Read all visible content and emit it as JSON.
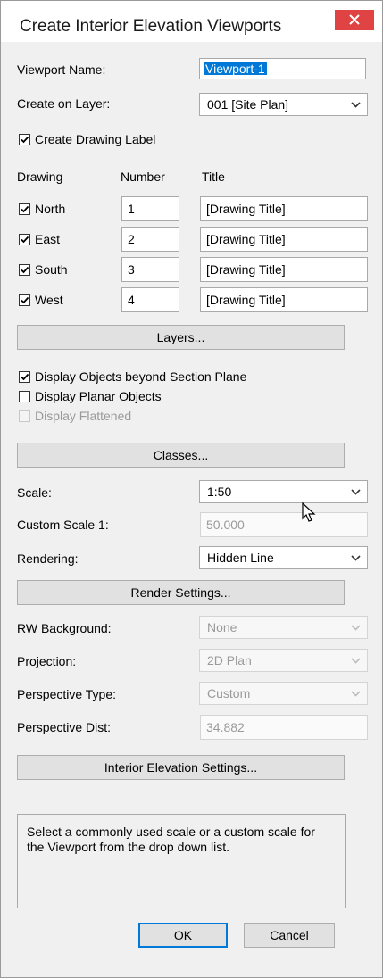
{
  "window": {
    "title": "Create Interior Elevation Viewports",
    "close_icon": "close-x-icon"
  },
  "viewport_name": {
    "label": "Viewport Name:",
    "value": "Viewport-1"
  },
  "layer": {
    "label": "Create on Layer:",
    "value": "001 [Site Plan]"
  },
  "create_drawing_label": {
    "label": "Create Drawing Label",
    "checked": true
  },
  "drawings": {
    "headers": {
      "drawing": "Drawing",
      "number": "Number",
      "title": "Title"
    },
    "rows": [
      {
        "name": "North",
        "checked": true,
        "number": "1",
        "title": "[Drawing Title]"
      },
      {
        "name": "East",
        "checked": true,
        "number": "2",
        "title": "[Drawing Title]"
      },
      {
        "name": "South",
        "checked": true,
        "number": "3",
        "title": "[Drawing Title]"
      },
      {
        "name": "West",
        "checked": true,
        "number": "4",
        "title": "[Drawing Title]"
      }
    ]
  },
  "buttons": {
    "layers": "Layers...",
    "classes": "Classes...",
    "render_settings": "Render Settings...",
    "interior_elevation_settings": "Interior Elevation Settings...",
    "ok": "OK",
    "cancel": "Cancel"
  },
  "options": {
    "display_beyond": {
      "label": "Display Objects beyond Section Plane",
      "checked": true
    },
    "display_planar": {
      "label": "Display Planar Objects",
      "checked": false
    },
    "display_flattened": {
      "label": "Display Flattened",
      "checked": false,
      "enabled": false
    }
  },
  "scale": {
    "label": "Scale:",
    "value": "1:50"
  },
  "custom_scale": {
    "label": "Custom Scale 1:",
    "value": "50.000"
  },
  "rendering": {
    "label": "Rendering:",
    "value": "Hidden Line"
  },
  "rw_background": {
    "label": "RW Background:",
    "value": "None"
  },
  "projection": {
    "label": "Projection:",
    "value": "2D Plan"
  },
  "perspective_type": {
    "label": "Perspective Type:",
    "value": "Custom"
  },
  "perspective_dist": {
    "label": "Perspective Dist:",
    "value": "34.882"
  },
  "help_text": "Select a commonly used scale or a custom scale for the Viewport from the drop down list.",
  "colors": {
    "accent": "#0078d7",
    "close": "#e04343",
    "dialog_bg": "#f0f0f0"
  }
}
